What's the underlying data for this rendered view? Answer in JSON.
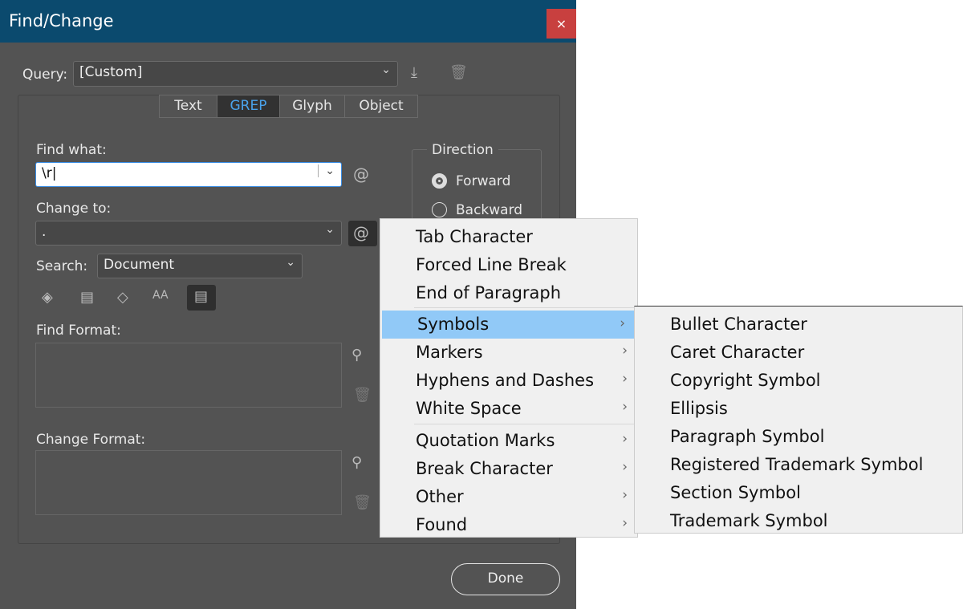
{
  "window": {
    "title": "Find/Change",
    "close": "×"
  },
  "query": {
    "label": "Query:",
    "value": "[Custom]"
  },
  "tabs": [
    {
      "label": "Text"
    },
    {
      "label": "GREP",
      "active": true
    },
    {
      "label": "Glyph"
    },
    {
      "label": "Object"
    }
  ],
  "find": {
    "label": "Find what:",
    "value": "\\r"
  },
  "change": {
    "label": "Change to:",
    "value": "."
  },
  "search": {
    "label": "Search:",
    "value": "Document"
  },
  "direction": {
    "label": "Direction",
    "options": [
      {
        "label": "Forward",
        "selected": true
      },
      {
        "label": "Backward",
        "selected": false
      }
    ]
  },
  "find_format": {
    "label": "Find Format:"
  },
  "change_format": {
    "label": "Change Format:"
  },
  "done": "Done",
  "menu": {
    "items": [
      "Tab Character",
      "Forced Line Break",
      "End of Paragraph",
      "Symbols",
      "Markers",
      "Hyphens and Dashes",
      "White Space",
      "Quotation Marks",
      "Break Character",
      "Other",
      "Found"
    ]
  },
  "submenu": {
    "items": [
      "Bullet Character",
      "Caret Character",
      "Copyright Symbol",
      "Ellipsis",
      "Paragraph Symbol",
      "Registered Trademark Symbol",
      "Section Symbol",
      "Trademark Symbol"
    ]
  },
  "colors": {
    "titlebar": "#0b4a6e",
    "highlight": "#91c9f7",
    "active_tab_text": "#4aa3ec",
    "close": "#c8403f"
  }
}
